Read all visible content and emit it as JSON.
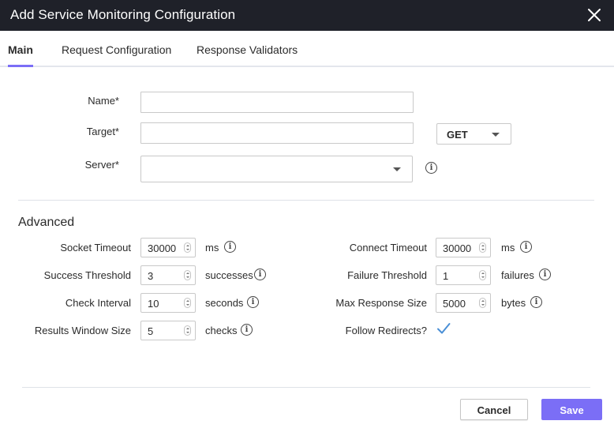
{
  "dialog": {
    "title": "Add Service Monitoring Configuration",
    "close_icon": "close-icon"
  },
  "tabs": [
    {
      "label": "Main",
      "active": true
    },
    {
      "label": "Request Configuration",
      "active": false
    },
    {
      "label": "Response Validators",
      "active": false
    }
  ],
  "main": {
    "name": {
      "label": "Name*",
      "value": ""
    },
    "target": {
      "label": "Target*",
      "value": "",
      "method": "GET"
    },
    "server": {
      "label": "Server*",
      "value": ""
    }
  },
  "advanced": {
    "title": "Advanced",
    "left": [
      {
        "label": "Socket Timeout",
        "value": "30000",
        "unit": "ms"
      },
      {
        "label": "Success Threshold",
        "value": "3",
        "unit": "successes"
      },
      {
        "label": "Check Interval",
        "value": "10",
        "unit": "seconds"
      },
      {
        "label": "Results Window Size",
        "value": "5",
        "unit": "checks"
      }
    ],
    "right": [
      {
        "label": "Connect Timeout",
        "value": "30000",
        "unit": "ms"
      },
      {
        "label": "Failure Threshold",
        "value": "1",
        "unit": "failures"
      },
      {
        "label": "Max Response Size",
        "value": "5000",
        "unit": "bytes"
      }
    ],
    "follow_redirects": {
      "label": "Follow Redirects?",
      "checked": true
    }
  },
  "footer": {
    "cancel_label": "Cancel",
    "save_label": "Save"
  },
  "colors": {
    "accent": "#7b6ef6",
    "titlebar": "#1f2129"
  }
}
